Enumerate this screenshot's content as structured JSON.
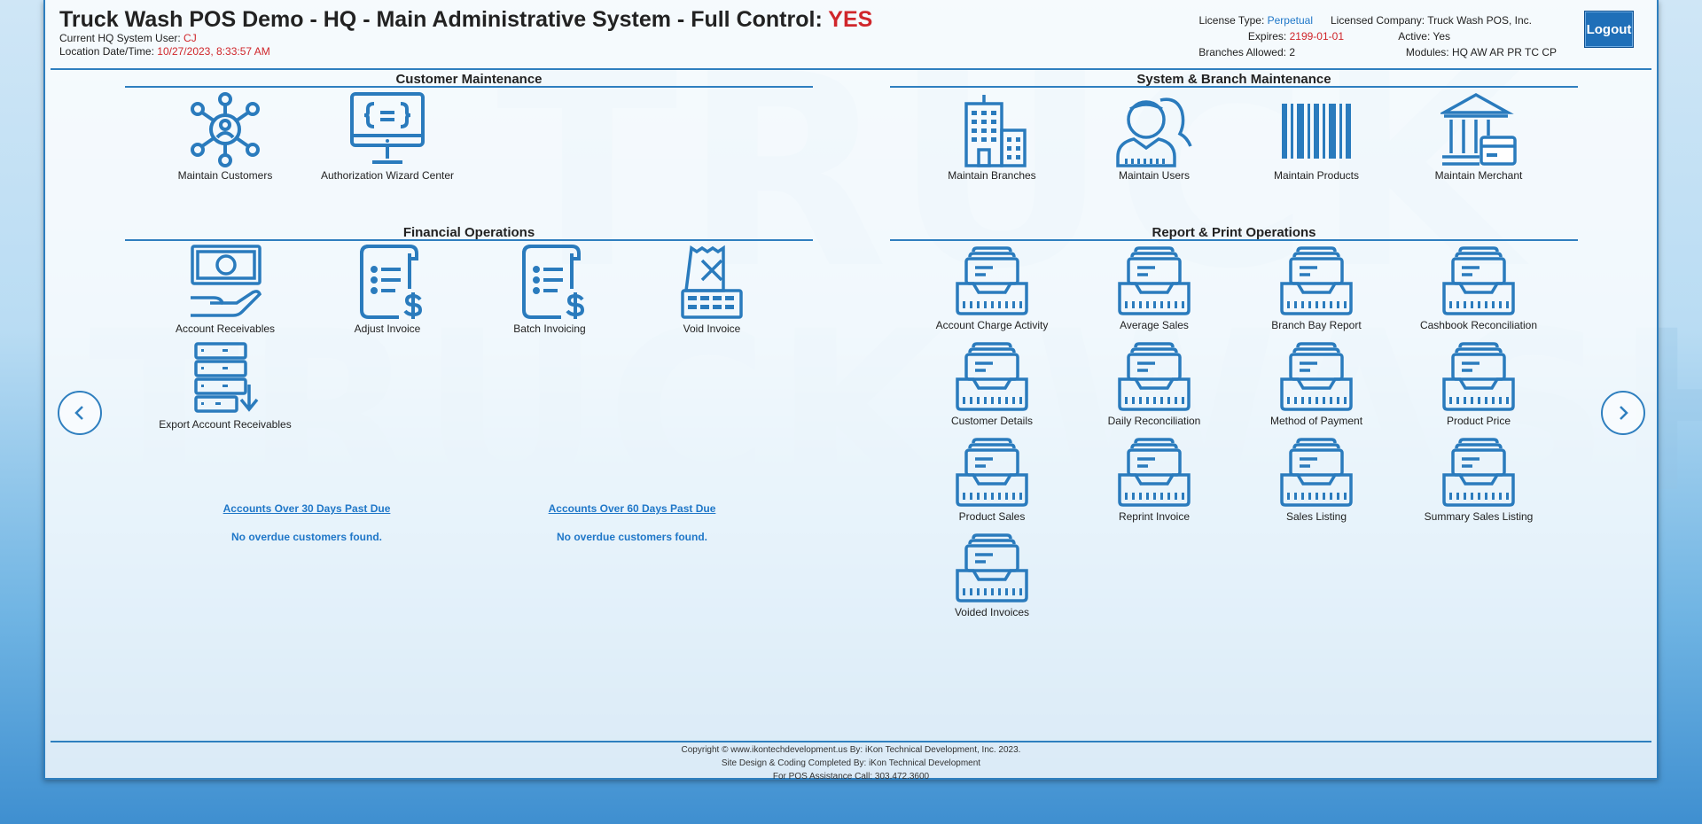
{
  "header": {
    "title_prefix": "Truck Wash POS Demo - HQ - Main Administrative System - Full Control: ",
    "title_flag": "YES",
    "user_label": "Current HQ System User: ",
    "user_value": "CJ",
    "datetime_label": "Location Date/Time: ",
    "datetime_value": "10/27/2023, 8:33:57 AM"
  },
  "license": {
    "type_label": "License Type:",
    "type_value": "Perpetual",
    "company_label": "Licensed Company:",
    "company_value": "Truck Wash POS, Inc.",
    "expires_label": "Expires:",
    "expires_value": "2199-01-01",
    "active_label": "Active:",
    "active_value": "Yes",
    "branches_label": "Branches Allowed:",
    "branches_value": "2",
    "modules_label": "Modules:",
    "modules_value": "HQ AW AR PR TC CP"
  },
  "logout_label": "Logout",
  "background_words": [
    "TRUCK",
    "TRUCK WASH"
  ],
  "sections": {
    "customer": {
      "title": "Customer Maintenance",
      "items": [
        {
          "label": "Maintain Customers",
          "icon": "network-user-icon"
        },
        {
          "label": "Authorization Wizard Center",
          "icon": "monitor-code-icon"
        }
      ]
    },
    "system": {
      "title": "System & Branch Maintenance",
      "items": [
        {
          "label": "Maintain Branches",
          "icon": "building-icon"
        },
        {
          "label": "Maintain Users",
          "icon": "users-icon"
        },
        {
          "label": "Maintain Products",
          "icon": "barcode-icon"
        },
        {
          "label": "Maintain Merchant",
          "icon": "bank-card-icon"
        }
      ]
    },
    "financial": {
      "title": "Financial Operations",
      "items": [
        {
          "label": "Account Receivables",
          "icon": "hand-money-icon"
        },
        {
          "label": "Adjust Invoice",
          "icon": "invoice-dollar-icon"
        },
        {
          "label": "Batch Invoicing",
          "icon": "invoice-dollar-icon"
        },
        {
          "label": "Void Invoice",
          "icon": "void-receipt-icon"
        },
        {
          "label": "Export Account Receivables",
          "icon": "server-export-icon"
        }
      ]
    },
    "report": {
      "title": "Report & Print Operations",
      "items": [
        {
          "label": "Account Charge Activity",
          "icon": "inbox-tray-icon"
        },
        {
          "label": "Average Sales",
          "icon": "inbox-tray-icon"
        },
        {
          "label": "Branch Bay Report",
          "icon": "inbox-tray-icon"
        },
        {
          "label": "Cashbook Reconciliation",
          "icon": "inbox-tray-icon"
        },
        {
          "label": "Customer Details",
          "icon": "inbox-tray-icon"
        },
        {
          "label": "Daily Reconciliation",
          "icon": "inbox-tray-icon"
        },
        {
          "label": "Method of Payment",
          "icon": "inbox-tray-icon"
        },
        {
          "label": "Product Price",
          "icon": "inbox-tray-icon"
        },
        {
          "label": "Product Sales",
          "icon": "inbox-tray-icon"
        },
        {
          "label": "Reprint Invoice",
          "icon": "inbox-tray-icon"
        },
        {
          "label": "Sales Listing",
          "icon": "inbox-tray-icon"
        },
        {
          "label": "Summary Sales Listing",
          "icon": "inbox-tray-icon"
        },
        {
          "label": "Voided Invoices",
          "icon": "inbox-tray-icon"
        }
      ]
    }
  },
  "overdue": {
    "over30_link": "Accounts Over 30 Days Past Due",
    "over30_msg": "No overdue customers found.",
    "over60_link": "Accounts Over 60 Days Past Due",
    "over60_msg": "No overdue customers found."
  },
  "footer": {
    "line1": "Copyright © www.ikontechdevelopment.us By: iKon Technical Development, Inc. 2023.",
    "line2": "Site Design & Coding Completed By: iKon Technical Development",
    "line3": "For POS Assistance Call: 303.472.3600"
  },
  "colors": {
    "accent": "#2f7fbf",
    "icon": "#2a7bbd",
    "alert": "#d0262b",
    "link": "#1f77c8"
  }
}
